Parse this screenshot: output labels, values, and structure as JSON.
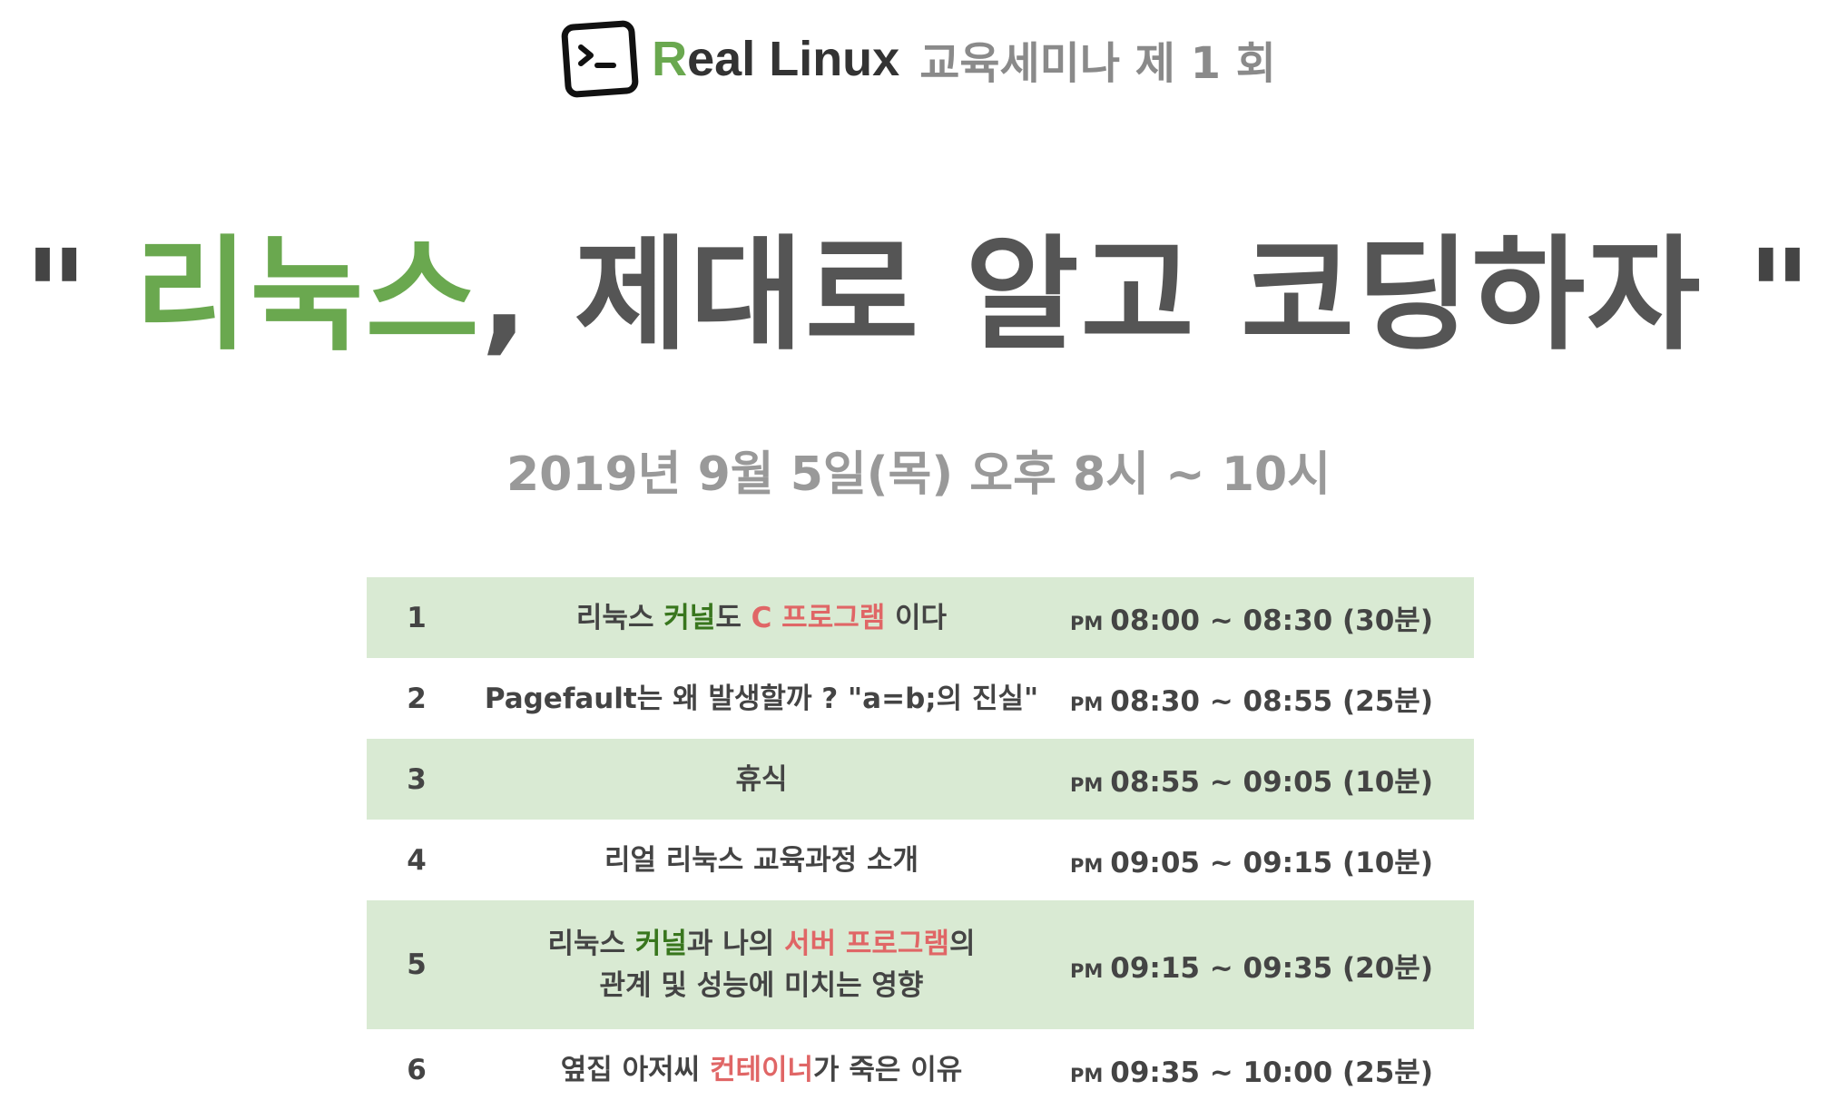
{
  "header": {
    "brand_first_letter": "R",
    "brand_rest": "eal Linux",
    "seminar": "교육세미나 제 1 회"
  },
  "title": {
    "open_quote": "\"",
    "accent": "리눅스",
    "rest": ", 제대로 알고 코딩하자",
    "close_quote": "\""
  },
  "date": "2019년 9월 5일(목)  오후 8시 ~ 10시",
  "colors": {
    "brand_green": "#6aa84f",
    "row_shade": "#d9ead3",
    "keyword_green": "#38761d",
    "keyword_red": "#e06666",
    "title_gray": "#555555",
    "muted_gray": "#999999"
  },
  "icons": {
    "logo": "terminal-icon"
  },
  "schedule": [
    {
      "num": "1",
      "topic": {
        "p1": "리눅스 ",
        "g1": "커널",
        "p2": "도 ",
        "r1": "C 프로그램",
        "p3": " 이다"
      },
      "pm": "PM",
      "time": "08:00 ~ 08:30 (30분)"
    },
    {
      "num": "2",
      "topic": {
        "text": "Pagefault는 왜 발생할까 ? \"a=b;의 진실\""
      },
      "pm": "PM",
      "time": "08:30 ~ 08:55 (25분)"
    },
    {
      "num": "3",
      "topic": {
        "text": "휴식"
      },
      "pm": "PM",
      "time": "08:55 ~ 09:05 (10분)"
    },
    {
      "num": "4",
      "topic": {
        "text": "리얼 리눅스 교육과정 소개"
      },
      "pm": "PM",
      "time": "09:05 ~ 09:15 (10분)"
    },
    {
      "num": "5",
      "topic": {
        "p1": "리눅스 ",
        "g1": "커널",
        "p2": "과 나의 ",
        "r1": "서버 프로그램",
        "p3": "의",
        "line2": "관계 및 성능에 미치는 영향"
      },
      "pm": "PM",
      "time": "09:15 ~ 09:35 (20분)"
    },
    {
      "num": "6",
      "topic": {
        "p1": "옆집 아저씨 ",
        "r1": "컨테이너",
        "p2": "가 죽은 이유"
      },
      "pm": "PM",
      "time": "09:35 ~ 10:00 (25분)"
    }
  ]
}
